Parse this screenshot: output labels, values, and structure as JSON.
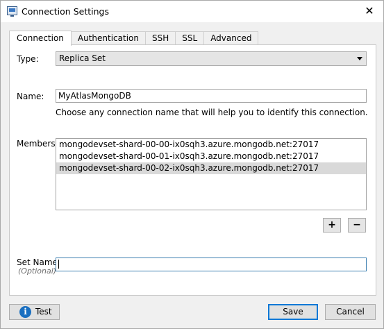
{
  "window": {
    "title": "Connection Settings",
    "close_glyph": "✕",
    "app_icon": "connection-settings-icon"
  },
  "tabs": [
    {
      "label": "Connection",
      "active": true
    },
    {
      "label": "Authentication",
      "active": false
    },
    {
      "label": "SSH",
      "active": false
    },
    {
      "label": "SSL",
      "active": false
    },
    {
      "label": "Advanced",
      "active": false
    }
  ],
  "connection": {
    "type_label": "Type:",
    "type_value": "Replica Set",
    "name_label": "Name:",
    "name_value": "MyAtlasMongoDB",
    "name_hint": "Choose any connection name that will help you to identify this connection.",
    "members_label": "Members:",
    "members": [
      {
        "address": "mongodevset-shard-00-00-ix0sqh3.azure.mongodb.net:27017",
        "selected": false
      },
      {
        "address": "mongodevset-shard-00-01-ix0sqh3.azure.mongodb.net:27017",
        "selected": false
      },
      {
        "address": "mongodevset-shard-00-02-ix0sqh3.azure.mongodb.net:27017",
        "selected": true
      }
    ],
    "add_glyph": "+",
    "remove_glyph": "−",
    "set_name_label": "Set Name:",
    "set_name_optional": "(Optional)",
    "set_name_value": ""
  },
  "footer": {
    "test_label": "Test",
    "test_icon_glyph": "i",
    "save_label": "Save",
    "cancel_label": "Cancel"
  },
  "colors": {
    "accent": "#0078d7",
    "info_icon": "#1a6fc0",
    "selected_row": "#d9d9d9"
  }
}
